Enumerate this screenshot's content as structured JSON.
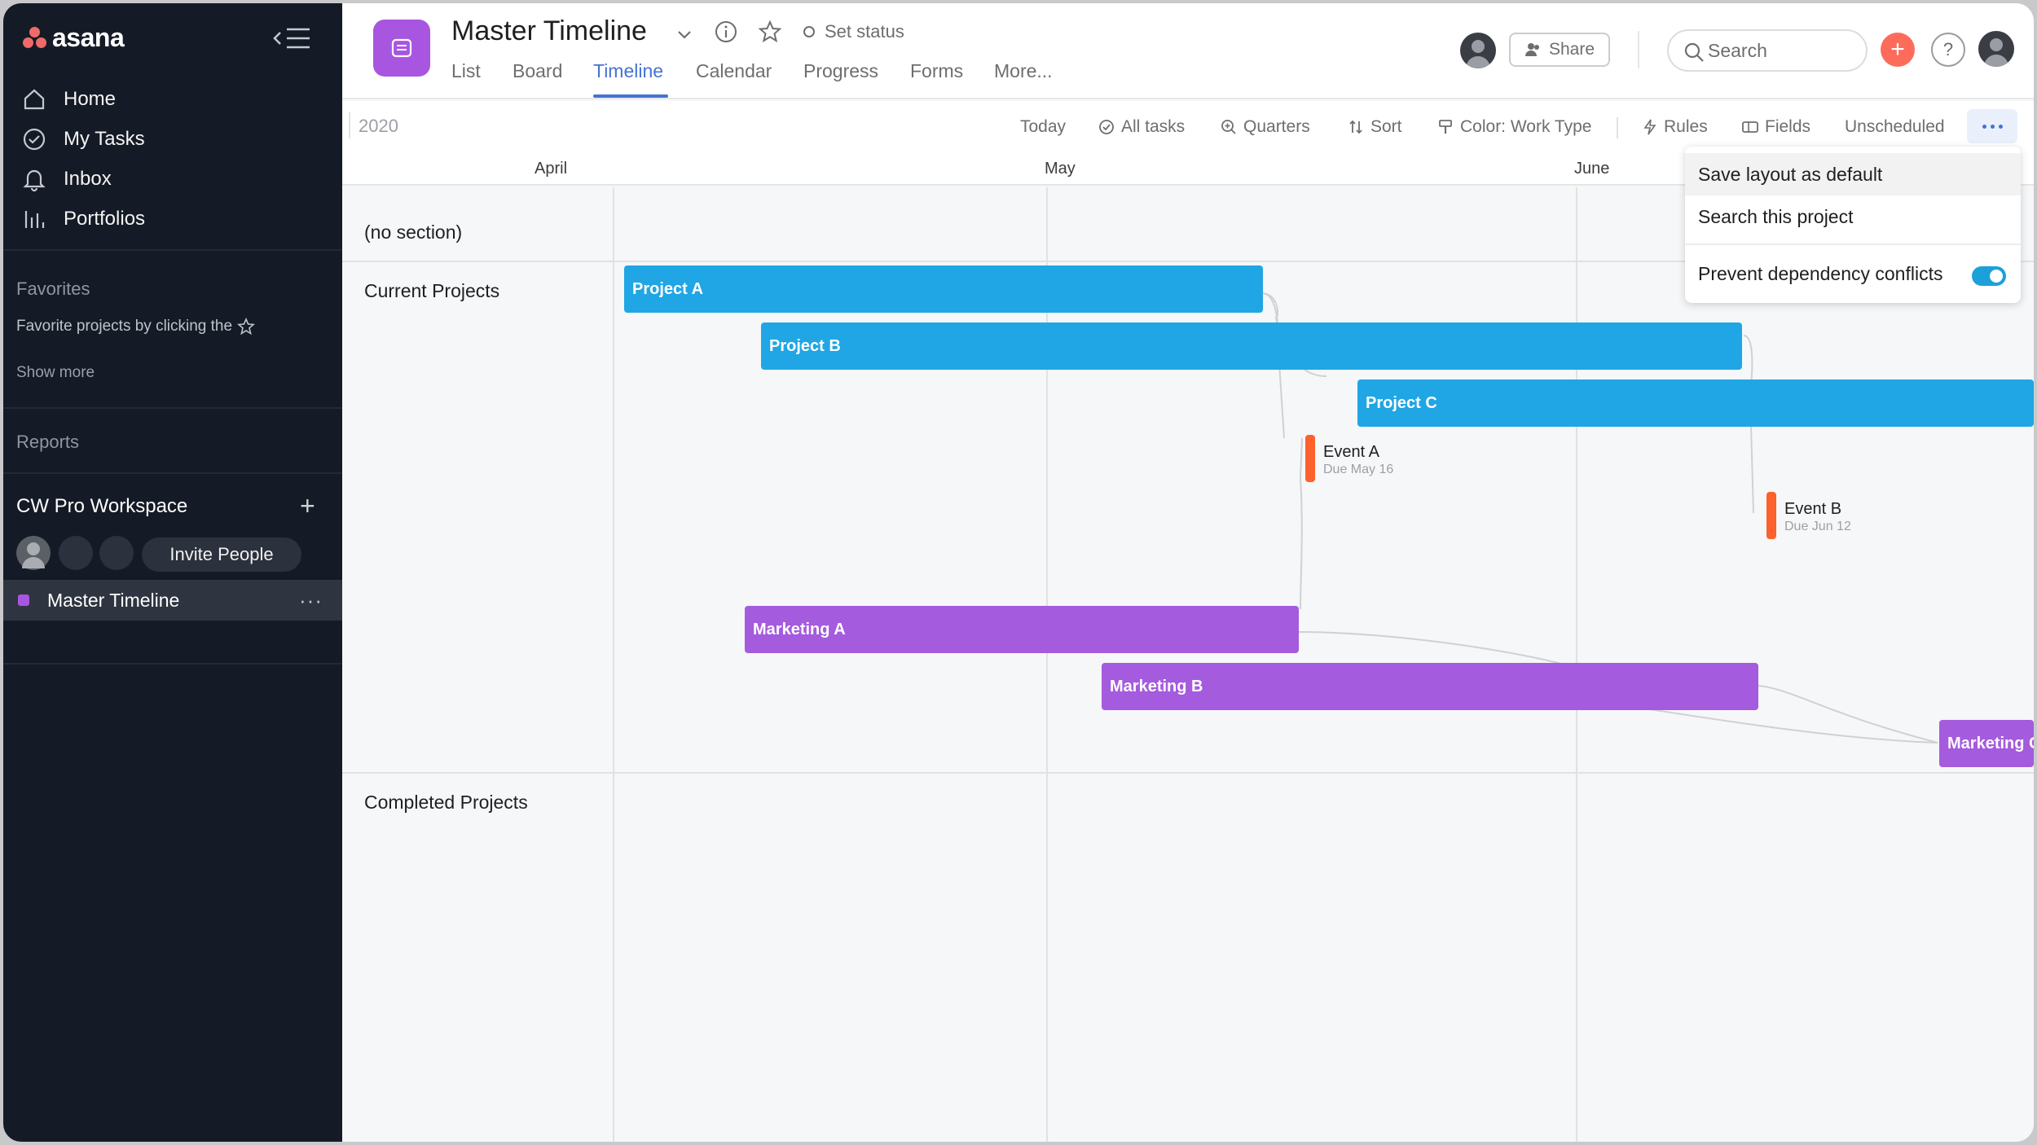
{
  "app": {
    "name": "asana"
  },
  "sidebar": {
    "nav": [
      {
        "label": "Home",
        "icon": "home-icon"
      },
      {
        "label": "My Tasks",
        "icon": "check-circle-icon"
      },
      {
        "label": "Inbox",
        "icon": "bell-icon"
      },
      {
        "label": "Portfolios",
        "icon": "bar-chart-icon"
      }
    ],
    "favorites": {
      "heading": "Favorites",
      "hint": "Favorite projects by clicking the",
      "show_more": "Show more"
    },
    "reports": {
      "heading": "Reports"
    },
    "workspace": {
      "name": "CW Pro Workspace",
      "invite_label": "Invite People"
    },
    "projects": [
      {
        "label": "Master Timeline",
        "color": "#a856e0"
      }
    ]
  },
  "header": {
    "title": "Master Timeline",
    "set_status": "Set status",
    "tabs": [
      "List",
      "Board",
      "Timeline",
      "Calendar",
      "Progress",
      "Forms",
      "More..."
    ],
    "active_tab": "Timeline",
    "share_label": "Share",
    "search_placeholder": "Search",
    "accent": "#4573d2"
  },
  "toolbar": {
    "year": "2020",
    "today": "Today",
    "all_tasks": "All tasks",
    "quarters": "Quarters",
    "sort": "Sort",
    "color": "Color: Work Type",
    "rules": "Rules",
    "fields": "Fields",
    "unscheduled": "Unscheduled"
  },
  "timeline": {
    "months": [
      "April",
      "May",
      "June"
    ],
    "sections": [
      "(no section)",
      "Current Projects",
      "Completed Projects"
    ],
    "tasks": [
      {
        "label": "Project A",
        "color": "#20a6e4"
      },
      {
        "label": "Project B",
        "color": "#20a6e4"
      },
      {
        "label": "Project C",
        "color": "#20a6e4"
      },
      {
        "label": "Marketing A",
        "color": "#a55bdd"
      },
      {
        "label": "Marketing B",
        "color": "#a55bdd"
      },
      {
        "label": "Marketing C",
        "color": "#a55bdd"
      }
    ],
    "milestones": [
      {
        "label": "Event A",
        "due": "Due May 16",
        "color": "#fd612c"
      },
      {
        "label": "Event B",
        "due": "Due Jun 12",
        "color": "#fd612c"
      }
    ]
  },
  "menu": {
    "items": [
      "Save layout as default",
      "Search this project",
      "Prevent dependency conflicts"
    ],
    "prevent_conflicts_on": true
  }
}
